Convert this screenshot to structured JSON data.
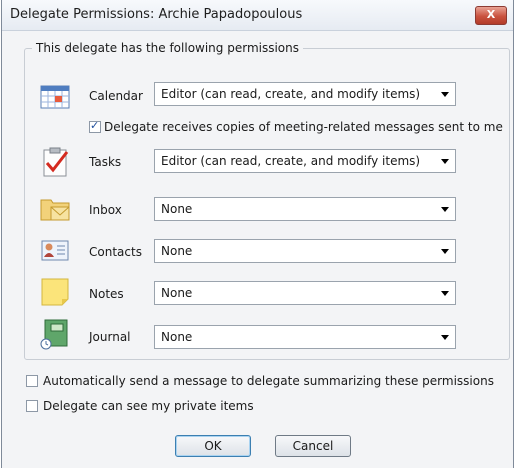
{
  "window": {
    "title": "Delegate Permissions: Archie Papadopoulous",
    "close_label": "X"
  },
  "group": {
    "title": "This delegate has the following permissions"
  },
  "rows": [
    {
      "icon": "calendar-icon",
      "label": "Calendar",
      "value": "Editor (can read, create, and modify items)"
    },
    {
      "icon": "tasks-icon",
      "label": "Tasks",
      "value": "Editor (can read, create, and modify items)"
    },
    {
      "icon": "inbox-icon",
      "label": "Inbox",
      "value": "None"
    },
    {
      "icon": "contacts-icon",
      "label": "Contacts",
      "value": "None"
    },
    {
      "icon": "notes-icon",
      "label": "Notes",
      "value": "None"
    },
    {
      "icon": "journal-icon",
      "label": "Journal",
      "value": "None"
    }
  ],
  "meeting_copies": {
    "label": "Delegate receives copies of meeting-related messages sent to me",
    "checked": true
  },
  "options": [
    {
      "label": "Automatically send a message to delegate summarizing these permissions",
      "checked": false
    },
    {
      "label": "Delegate can see my private items",
      "checked": false
    }
  ],
  "buttons": {
    "ok": "OK",
    "cancel": "Cancel"
  },
  "colors": {
    "close_button": "#c9523f",
    "checkbox_mark": "#1f4e9d",
    "window_bg": "#f3f4f6"
  }
}
